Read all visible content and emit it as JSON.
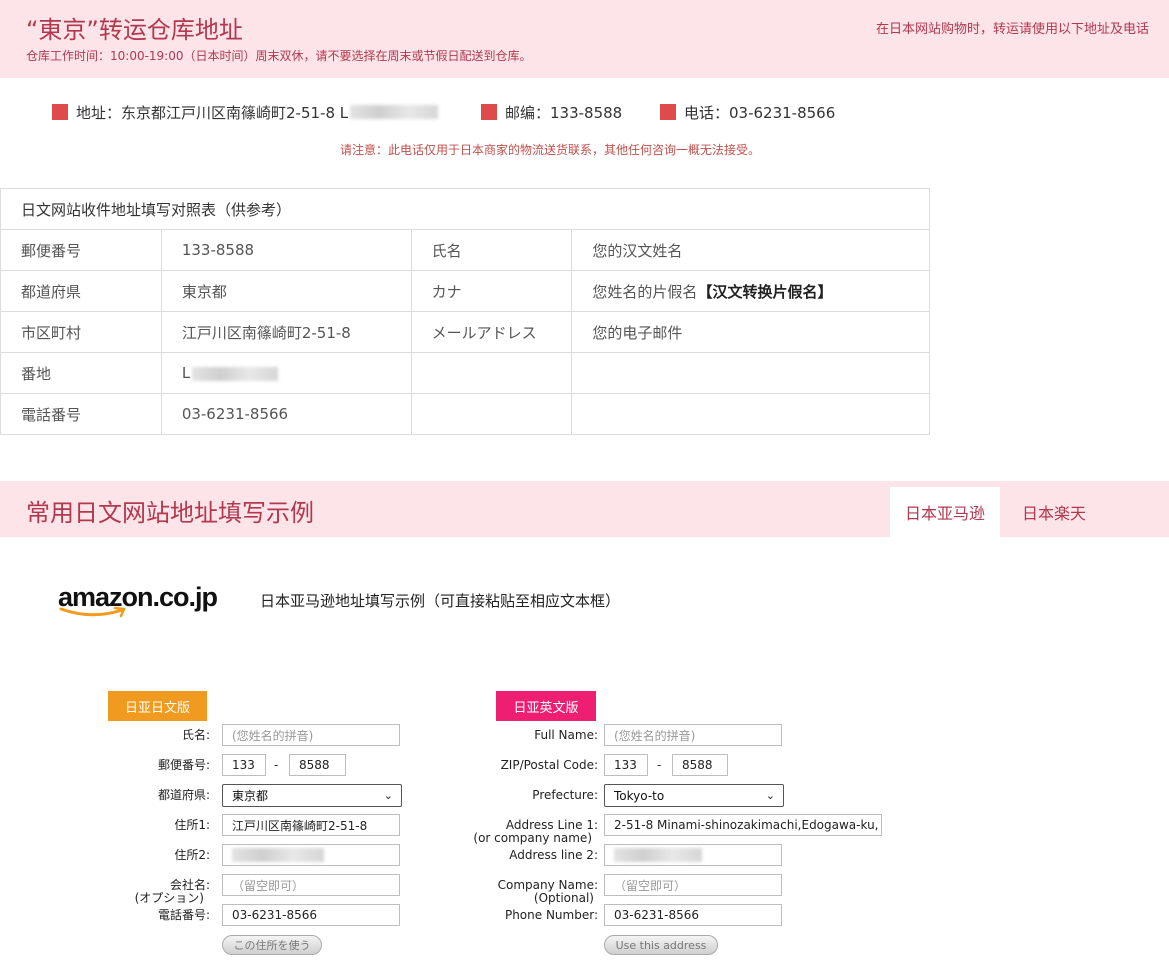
{
  "header": {
    "title": "“東京”转运仓库地址",
    "hours": "仓库工作时间：10:00-19:00（日本时间）周末双休，请不要选择在周末或节假日配送到仓库。",
    "right_note": "在日本网站购物时，转运请使用以下地址及电话"
  },
  "address": {
    "address_label": "地址：东京都江戸川区南篠崎町2-51-8 L",
    "zip_label": "邮编：133-8588",
    "phone_label": "电话：03-6231-8566",
    "notice": "请注意：此电话仅用于日本商家的物流送货联系，其他任何咨询一概无法接受。"
  },
  "ref_table": {
    "caption": "日文网站收件地址填写对照表（供参考）",
    "rows": [
      {
        "k1": "郵便番号",
        "v1": "133-8588",
        "k2": "氏名",
        "v2": "您的汉文姓名"
      },
      {
        "k1": "都道府県",
        "v1": "東京都",
        "k2": "カナ",
        "v2": "您姓名的片假名",
        "v2_strong": "【汉文转换片假名】"
      },
      {
        "k1": "市区町村",
        "v1": "江戸川区南篠崎町2-51-8",
        "k2": "メールアドレス",
        "v2": "您的电子邮件"
      },
      {
        "k1": "番地",
        "v1": "L",
        "k2": "",
        "v2": ""
      },
      {
        "k1": "電話番号",
        "v1": "03-6231-8566",
        "k2": "",
        "v2": ""
      }
    ]
  },
  "section2": {
    "title": "常用日文网站地址填写示例",
    "tabs": [
      {
        "label": "日本亚马逊",
        "active": true
      },
      {
        "label": "日本楽天",
        "active": false
      }
    ]
  },
  "amazon": {
    "logo_text": "amazon.co.jp",
    "description": "日本亚马逊地址填写示例（可直接粘贴至相应文本框）"
  },
  "form_jp": {
    "badge": "日亚日文版",
    "name_label": "氏名:",
    "name_placeholder": "(您姓名的拼音)",
    "zip_label": "郵便番号:",
    "zip1": "133",
    "zip_dash": "-",
    "zip2": "8588",
    "pref_label": "都道府県:",
    "pref_value": "東京都",
    "addr1_label": "住所1:",
    "addr1_value": "江戸川区南篠崎町2-51-8",
    "addr2_label": "住所2:",
    "company_label": "会社名:",
    "company_optional": "(オプション)",
    "company_placeholder": "（留空即可）",
    "phone_label": "電話番号:",
    "phone_value": "03-6231-8566",
    "button": "この住所を使う"
  },
  "form_en": {
    "badge": "日亚英文版",
    "name_label": "Full Name:",
    "name_placeholder": "(您姓名的拼音)",
    "zip_label": "ZIP/Postal Code:",
    "zip1": "133",
    "zip_dash": "-",
    "zip2": "8588",
    "pref_label": "Prefecture:",
    "pref_value": "Tokyo-to",
    "addr1_label": "Address Line 1:",
    "addr1_sub": "(or company name)",
    "addr1_value": "2-51-8 Minami-shinozakimachi,Edogawa-ku,",
    "addr2_label": "Address line 2:",
    "company_label": "Company Name:",
    "company_optional": "(Optional)",
    "company_placeholder": "（留空即可）",
    "phone_label": "Phone Number:",
    "phone_value": "03-6231-8566",
    "button": "Use this address"
  },
  "colors": {
    "banner_bg": "#fce4e8",
    "brand_red": "#b2384f",
    "marker_red": "#dd4b4b",
    "badge_orange": "#f09a1f",
    "badge_pink": "#ee1f73"
  }
}
